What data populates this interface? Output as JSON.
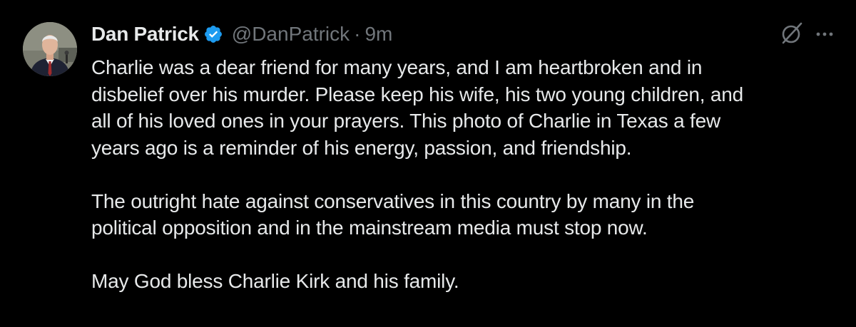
{
  "author": {
    "display_name": "Dan Patrick",
    "handle": "@DanPatrick",
    "separator": "·",
    "time": "9m"
  },
  "icons": {
    "avatar": "profile-photo",
    "verified": "verified-badge-icon",
    "grok": "grok-icon",
    "more": "more-horizontal-icon"
  },
  "colors": {
    "background": "#000000",
    "text_primary": "#e7e9ea",
    "text_secondary": "#71767b",
    "verified_blue": "#1d9bf0"
  },
  "tweet": {
    "paragraph1_lines": [
      "Charlie was a dear friend for many years, and I am heartbroken and in",
      "disbelief over his murder. Please keep his wife, his two young children, and",
      "all of his loved ones in your prayers. This photo of Charlie in Texas a few",
      "years ago is a reminder of his energy, passion, and friendship."
    ],
    "paragraph2_lines": [
      "The outright hate against conservatives in this country by many in the",
      "political opposition and in the mainstream media must stop now."
    ],
    "paragraph3_lines": [
      "May God bless Charlie Kirk and his family."
    ]
  }
}
